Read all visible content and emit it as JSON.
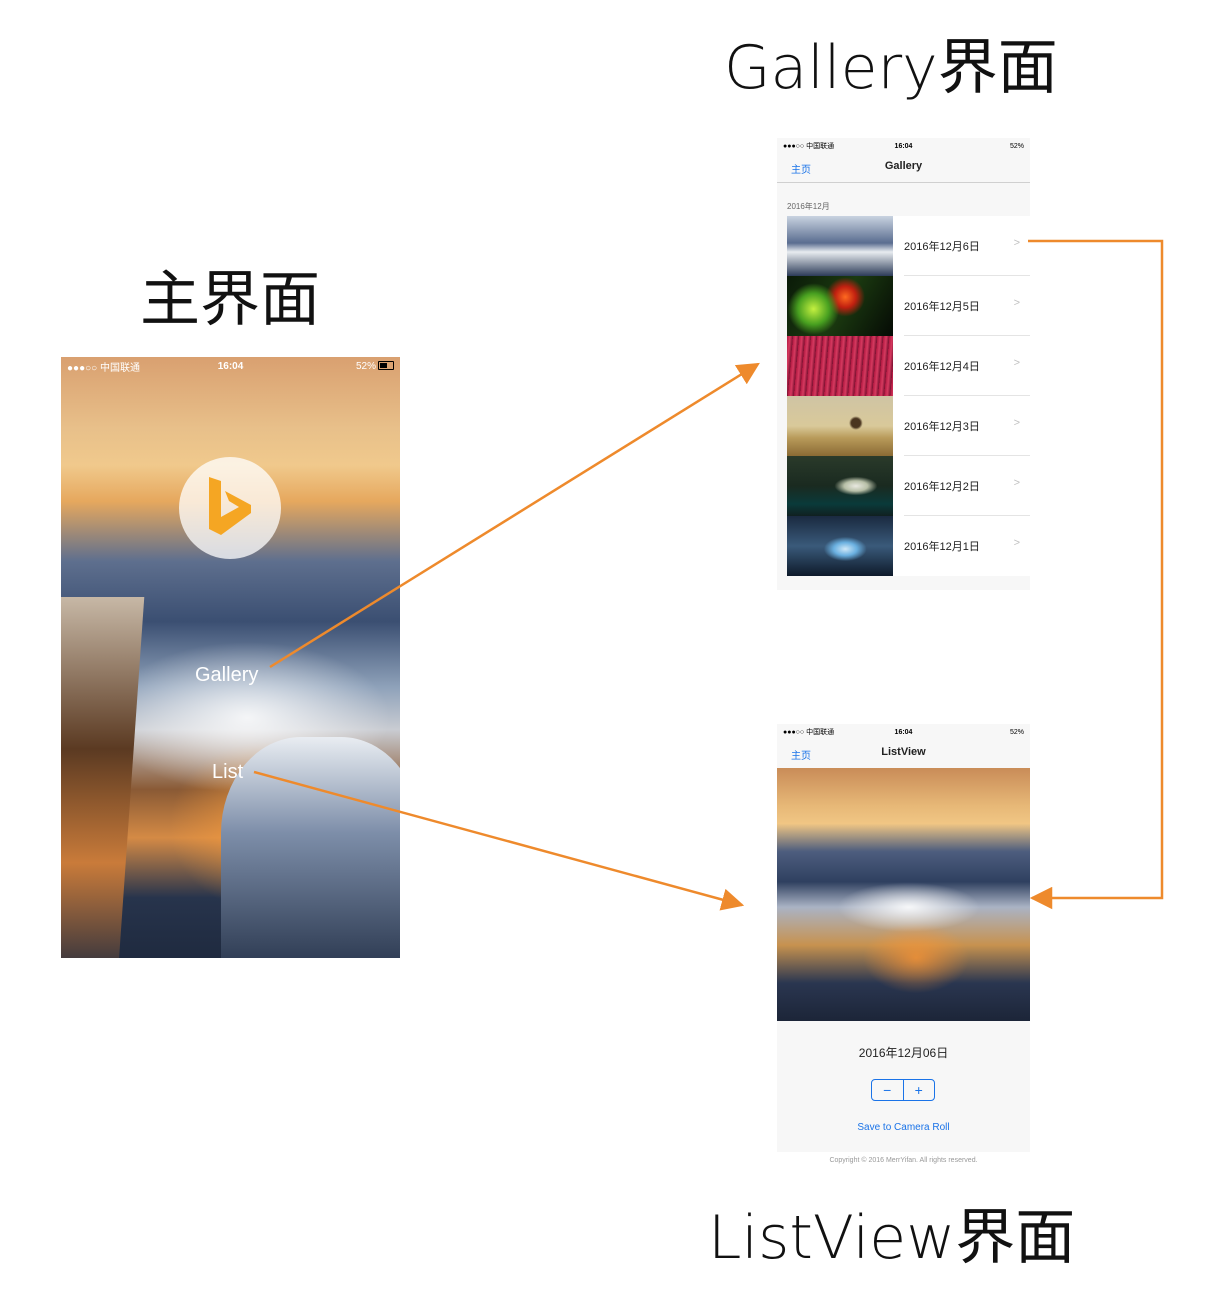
{
  "titles": {
    "main": "主界面",
    "gallery": "Gallery界面",
    "listview": "ListView界面"
  },
  "status_bar": {
    "carrier": "●●●○○ 中国联通",
    "time": "16:04",
    "battery": "52%"
  },
  "main_screen": {
    "gallery_link": "Gallery",
    "list_link": "List"
  },
  "gallery_screen": {
    "back": "主页",
    "title": "Gallery",
    "section": "2016年12月",
    "rows": [
      "2016年12月6日",
      "2016年12月5日",
      "2016年12月4日",
      "2016年12月3日",
      "2016年12月2日",
      "2016年12月1日"
    ],
    "chevron": ">"
  },
  "list_screen": {
    "back": "主页",
    "title": "ListView",
    "date": "2016年12月06日",
    "minus": "−",
    "plus": "+",
    "save": "Save to Camera Roll",
    "copyright": "Copyright © 2016 MerrYifan. All rights reserved."
  },
  "colors": {
    "arrow": "#ee8a2c",
    "link_blue": "#1a73e8",
    "bing_orange": "#f5a623"
  }
}
